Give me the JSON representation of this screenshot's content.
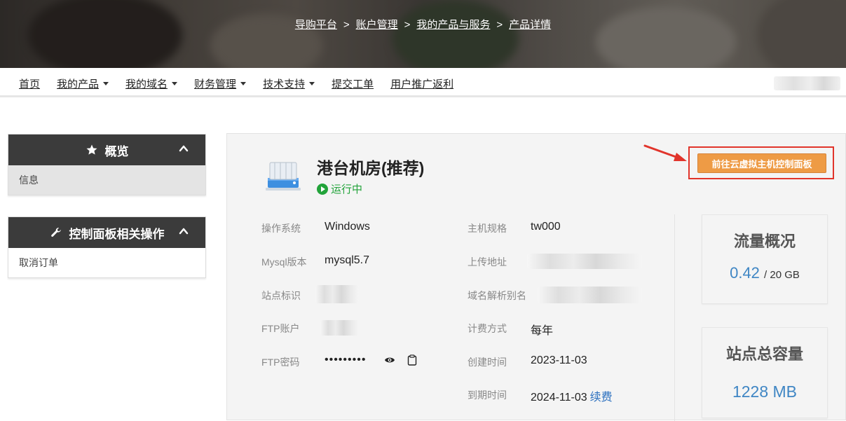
{
  "breadcrumb": {
    "items": [
      "导购平台",
      "账户管理",
      "我的产品与服务",
      "产品详情"
    ],
    "separator": ">"
  },
  "nav": {
    "items": [
      {
        "label": "首页",
        "dropdown": false
      },
      {
        "label": "我的产品",
        "dropdown": true
      },
      {
        "label": "我的域名",
        "dropdown": true
      },
      {
        "label": "财务管理",
        "dropdown": true
      },
      {
        "label": "技术支持",
        "dropdown": true
      },
      {
        "label": "提交工单",
        "dropdown": false
      },
      {
        "label": "用户推广返利",
        "dropdown": false
      }
    ]
  },
  "sidebar": {
    "overview": {
      "title": "概览",
      "icon": "star-icon",
      "item": "信息"
    },
    "panel_ops": {
      "title": "控制面板相关操作",
      "icon": "wrench-icon",
      "item": "取消订单"
    }
  },
  "product": {
    "name": "港台机房(推荐)",
    "status": "运行中",
    "cta_label": "前往云虚拟主机控制面板"
  },
  "details": {
    "os_label": "操作系统",
    "os_value": "Windows",
    "mysql_label": "Mysql版本",
    "mysql_value": "mysql5.7",
    "site_id_label": "站点标识",
    "ftp_user_label": "FTP账户",
    "ftp_pass_label": "FTP密码",
    "ftp_pass_value": "•••••••••",
    "spec_label": "主机规格",
    "spec_value": "tw000",
    "upload_label": "上传地址",
    "alias_label": "域名解析别名",
    "billing_label": "计费方式",
    "billing_value": "每年",
    "created_label": "创建时间",
    "created_value": "2023-11-03",
    "expire_label": "到期时间",
    "expire_value": "2024-11-03",
    "renew_label": "续费"
  },
  "stats": {
    "traffic_title": "流量概况",
    "traffic_used": "0.42",
    "traffic_total": "/ 20 GB",
    "capacity_title": "站点总容量",
    "capacity_value": "1228 MB"
  },
  "colors": {
    "accent_orange": "#ee9b45",
    "highlight_red": "#e1342b",
    "status_green": "#22a33a",
    "link_blue": "#3f86c4"
  }
}
